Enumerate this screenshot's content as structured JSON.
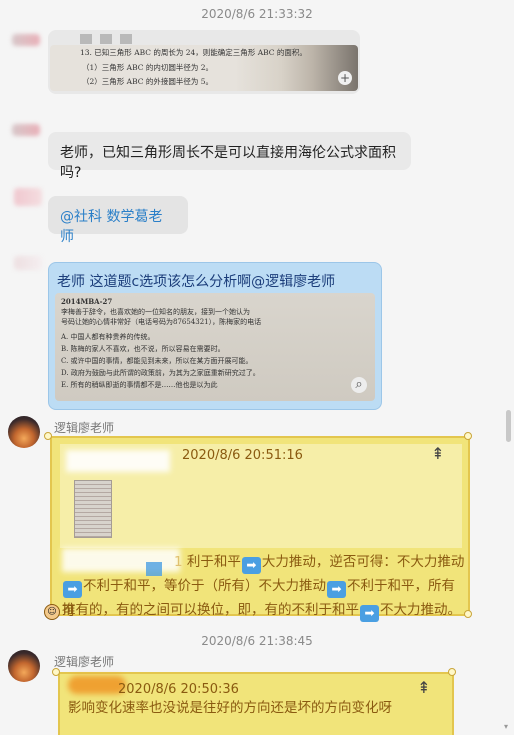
{
  "timestamps": [
    "2020/8/6 21:33:32",
    "2020/8/6 21:38:45"
  ],
  "messages": {
    "m1_image": {
      "lines": [
        "13. 已知三角形 ABC 的周长为 24，则能确定三角形 ABC 的面积。",
        "（1）三角形 ABC 的内切圆半径为 2。",
        "（2）三角形 ABC 的外接圆半径为 5。"
      ]
    },
    "m2_text": "老师，已知三角形周长不是可以直接用海伦公式求面积吗?",
    "m3_text": "@社科  数学葛老师",
    "m4": {
      "text": "老师 这道题c选项该怎么分析啊@逻辑廖老师",
      "image_lines": [
        "2014MBA-27",
        "李梅善于辞令，也喜欢她的一位知名的朋友，接到一个她认为",
        "号码让她的心情非常好（电话号码为87654321），陈梅家的电话",
        "A. 中国人都有种贵养的传统。",
        "B. 陈梅的家人不喜欢，也不说，所以容易在需要时。",
        "C. 或许中国的事情，都能见到未来，所以在某方面开展可能。",
        "D. 政府为鼓励与此所谓的政策前，为其为之家庭重新研究过了。",
        "E. 所有的稍纵即逝的事情都不是……他也是以为此"
      ]
    }
  },
  "sender": "逻辑廖老师",
  "note1": {
    "timestamp": "2020/8/6 20:51:16",
    "prefix_hidden": "1",
    "lines": [
      [
        "利于和平",
        "arrow",
        "大力推动，逆否可得：不大力推动"
      ],
      [
        "arrow",
        "不利于和平，等价于（所有）不大力推动",
        "arrow",
        "不利于和平，所有可"
      ],
      [
        "推有的，有的之间可以换位，即，有的不利于和平",
        "arrow",
        "不大力推动。"
      ]
    ]
  },
  "note2": {
    "timestamp": "2020/8/6 20:50:36",
    "line1": "影响变化速率也没说是往好的方向还是坏的方向变化呀"
  },
  "icons": {
    "pin": "pin-icon",
    "zoom": "zoom-icon",
    "arrow": "right-arrow-icon"
  },
  "colors": {
    "background": "#f5f5f5",
    "gray_bubble": "#ececec",
    "blue_bubble": "#bcdcf4",
    "note_yellow": "#f1e47a",
    "note_border": "#e3c64e",
    "note_text": "#8a5a10",
    "arrow_blue": "#4a9fe2"
  }
}
